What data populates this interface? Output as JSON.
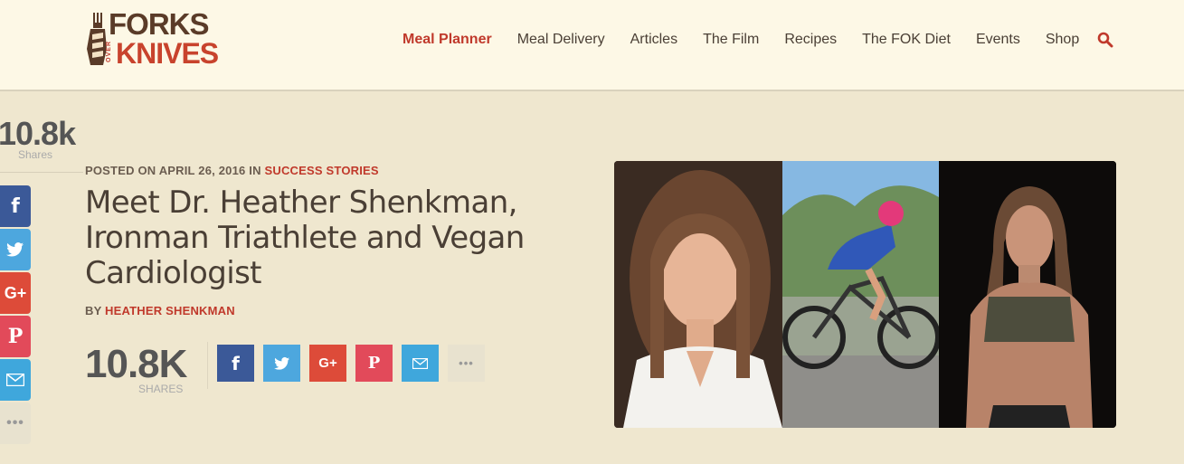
{
  "brand": {
    "logo_top": "FORKS",
    "logo_over": "OVER",
    "logo_bottom": "KNIVES"
  },
  "nav": {
    "items": [
      {
        "label": "Meal Planner",
        "active": true
      },
      {
        "label": "Meal Delivery"
      },
      {
        "label": "Articles"
      },
      {
        "label": "The Film"
      },
      {
        "label": "Recipes"
      },
      {
        "label": "The FOK Diet"
      },
      {
        "label": "Events"
      },
      {
        "label": "Shop"
      }
    ],
    "search_icon": "search-icon"
  },
  "side_share": {
    "count": "10.8k",
    "label": "Shares",
    "buttons": [
      "facebook-icon",
      "twitter-icon",
      "google-plus-icon",
      "pinterest-icon",
      "email-icon",
      "more-icon"
    ]
  },
  "article": {
    "posted_prefix": "POSTED ON APRIL 26, 2016 IN",
    "category": "SUCCESS STORIES",
    "title": "Meet Dr. Heather Shenkman, Ironman Triathlete and Vegan Cardiologist",
    "by_prefix": "BY",
    "author": "HEATHER SHENKMAN"
  },
  "inline_share": {
    "count": "10.8K",
    "label": "SHARES"
  },
  "colors": {
    "accent": "#c0392b",
    "facebook": "#3b5998",
    "twitter": "#4da7de",
    "google_plus": "#dd4b39",
    "pinterest": "#e24a5a",
    "email": "#3fa7dc"
  }
}
